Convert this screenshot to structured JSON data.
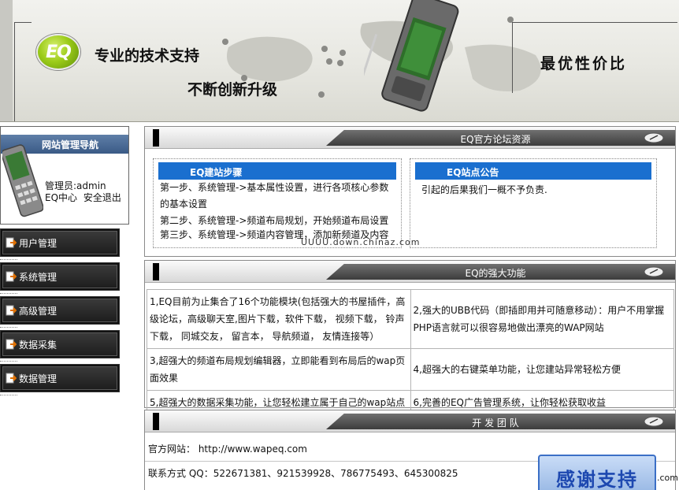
{
  "banner": {
    "logo_text": "EQ",
    "tagline_1": "专业的技术支持",
    "tagline_2": "不断创新升级",
    "tagline_3": "最优性价比"
  },
  "sidebar": {
    "title": "网站管理导航",
    "admin_label": "管理员:admin",
    "link_center": "EQ中心",
    "link_logout": "安全退出",
    "menu": [
      {
        "label": "用户管理"
      },
      {
        "label": "系统管理"
      },
      {
        "label": "高级管理"
      },
      {
        "label": "数据采集"
      },
      {
        "label": "数据管理"
      }
    ]
  },
  "panel_forum": {
    "title": "EQ官方论坛资源",
    "steps": {
      "heading": "EQ建站步骤",
      "lines": [
        "第一步、系统管理->基本属性设置，进行各项核心参数",
        "的基本设置",
        "第二步、系统管理->频道布局规划，开始频道布局设置",
        "第三步、系统管理->频道内容管理，添加新频道及内容"
      ]
    },
    "notice": {
      "heading": "EQ站点公告",
      "text": "引起的后果我们一概不予负责."
    },
    "watermark": "UUUU.down.chinaz.com"
  },
  "panel_features": {
    "title": "EQ的强大功能",
    "rows": [
      [
        "1,EQ目前为止集合了16个功能模块(包括强大的书屋插件，高级论坛，高级聊天室,图片下载，软件下载， 视频下载， 铃声下载， 同城交友， 留言本， 导航频道， 友情连接等）",
        "2,强大的UBB代码（即插即用并可随意移动）：用户不用掌握PHP语言就可以很容易地做出漂亮的WAP网站"
      ],
      [
        "3,超强大的频道布局规划编辑器，立即能看到布局后的wap页面效果",
        "4,超强大的右键菜单功能，让您建站异常轻松方便"
      ],
      [
        "5,超强大的数据采集功能，让您轻松建立属于自己的wap站点",
        "6,完善的EQ广告管理系统，让你轻松获取收益"
      ]
    ]
  },
  "panel_team": {
    "title": "开 发 团 队",
    "website": "官方网站： http://www.wapeq.com",
    "contact": "联系方式 QQ：522671381、921539928、786775493、645300825"
  },
  "thanks_badge": {
    "text": "感谢支持",
    "suffix": ".com"
  }
}
